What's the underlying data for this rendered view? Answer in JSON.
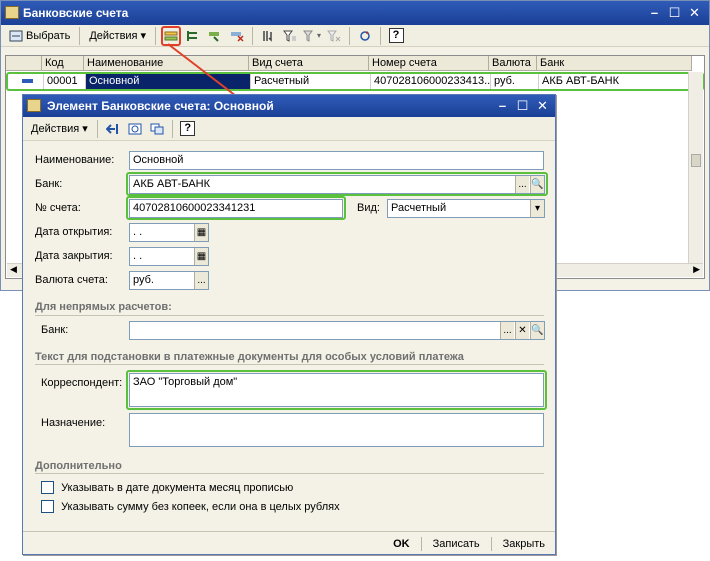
{
  "main_window": {
    "title": "Банковские счета",
    "toolbar": {
      "select_label": "Выбрать",
      "actions_label": "Действия"
    },
    "columns": [
      "Код",
      "Наименование",
      "Вид счета",
      "Номер счета",
      "Валюта",
      "Банк"
    ],
    "rows": [
      {
        "code": "00001",
        "name": "Основной",
        "type": "Расчетный",
        "number": "407028106000233413...",
        "currency": "руб.",
        "bank": "АКБ АВТ-БАНК"
      }
    ]
  },
  "dialog": {
    "title": "Элемент Банковские счета: Основной",
    "actions_label": "Действия",
    "labels": {
      "name": "Наименование:",
      "bank": "Банк:",
      "account": "№ счета:",
      "kind": "Вид:",
      "open_date": "Дата открытия:",
      "close_date": "Дата закрытия:",
      "currency": "Валюта счета:",
      "indirect_bank": "Банк:",
      "correspondent": "Корреспондент:",
      "purpose": "Назначение:"
    },
    "values": {
      "name": "Основной",
      "bank": "АКБ АВТ-БАНК",
      "account": "40702810600023341231",
      "kind": "Расчетный",
      "open_date": " .  .",
      "close_date": " .  .",
      "currency": "руб.",
      "indirect_bank": "",
      "correspondent": "ЗАО \"Торговый дом\"",
      "purpose": ""
    },
    "sections": {
      "indirect": "Для непрямых расчетов:",
      "payment_text": "Текст для подстановки в платежные документы для особых условий платежа",
      "extra": "Дополнительно"
    },
    "checkboxes": [
      {
        "label": "Указывать в дате документа месяц прописью",
        "checked": false
      },
      {
        "label": "Указывать сумму без копеек, если она в целых рублях",
        "checked": false
      }
    ],
    "buttons": {
      "ok": "OK",
      "save": "Записать",
      "close": "Закрыть"
    }
  },
  "colors": {
    "title_bar": "#1b3f96",
    "highlight_green": "#5ac13e",
    "highlight_red": "#e0402a",
    "selection": "#0a246a"
  }
}
